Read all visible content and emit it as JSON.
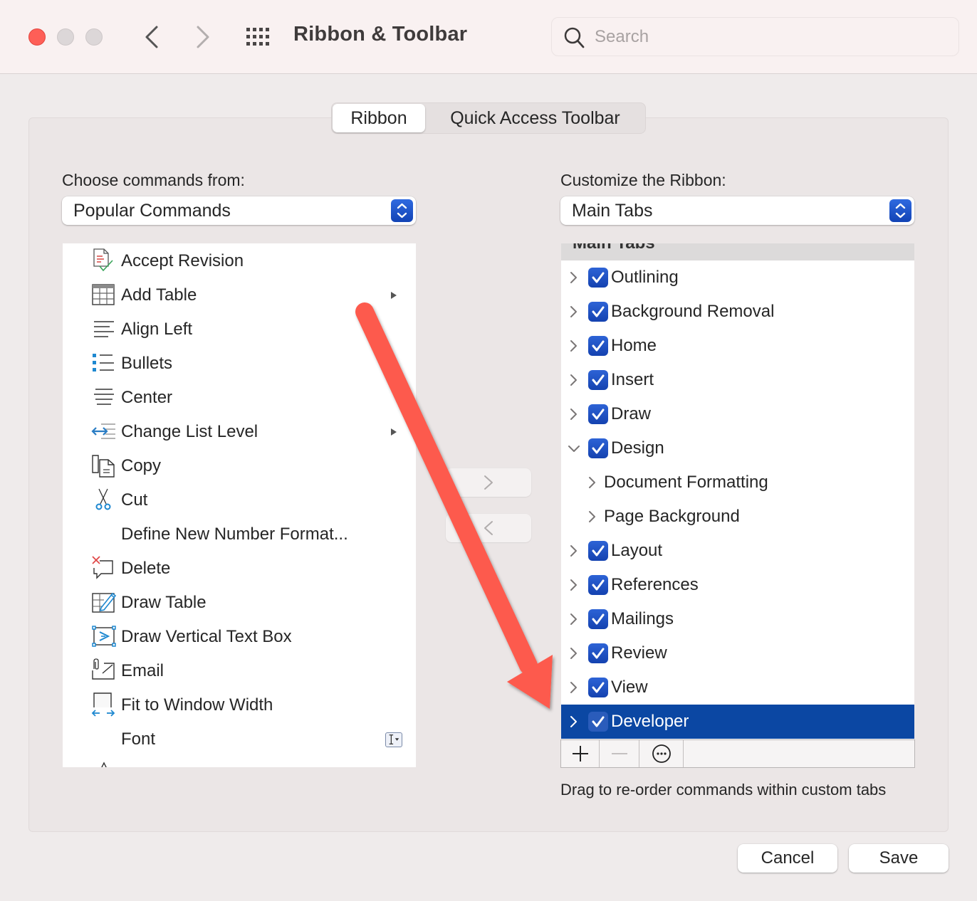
{
  "window": {
    "title": "Ribbon & Toolbar",
    "search_placeholder": "Search"
  },
  "tabs": [
    {
      "label": "Ribbon",
      "active": true
    },
    {
      "label": "Quick Access Toolbar",
      "active": false
    }
  ],
  "left": {
    "label": "Choose commands from:",
    "dropdown_value": "Popular Commands",
    "commands": [
      {
        "label": "Accept Revision",
        "icon": "accept-revision-icon",
        "submenu": false
      },
      {
        "label": "Add Table",
        "icon": "table-icon",
        "submenu": true
      },
      {
        "label": "Align Left",
        "icon": "align-left-icon",
        "submenu": false
      },
      {
        "label": "Bullets",
        "icon": "bullets-icon",
        "submenu": false
      },
      {
        "label": "Center",
        "icon": "align-center-icon",
        "submenu": false
      },
      {
        "label": "Change List Level",
        "icon": "change-list-level-icon",
        "submenu": true
      },
      {
        "label": "Copy",
        "icon": "copy-icon",
        "submenu": false
      },
      {
        "label": "Cut",
        "icon": "scissors-icon",
        "submenu": false
      },
      {
        "label": "Define New Number Format...",
        "icon": null,
        "submenu": false
      },
      {
        "label": "Delete",
        "icon": "delete-comment-icon",
        "submenu": false
      },
      {
        "label": "Draw Table",
        "icon": "draw-table-icon",
        "submenu": false
      },
      {
        "label": "Draw Vertical Text Box",
        "icon": "vertical-text-box-icon",
        "submenu": false
      },
      {
        "label": "Email",
        "icon": "email-attachment-icon",
        "submenu": false
      },
      {
        "label": "Fit to Window Width",
        "icon": "fit-width-icon",
        "submenu": false
      },
      {
        "label": "Font",
        "icon": null,
        "submenu": false,
        "trailing": "font-picker-icon"
      }
    ]
  },
  "middle": {
    "add_label": "Add",
    "remove_label": "Remove"
  },
  "right": {
    "label": "Customize the Ribbon:",
    "dropdown_value": "Main Tabs",
    "header": "Main Tabs",
    "items": [
      {
        "label": "Outlining",
        "checked": true,
        "expanded": false,
        "level": 0
      },
      {
        "label": "Background Removal",
        "checked": true,
        "expanded": false,
        "level": 0
      },
      {
        "label": "Home",
        "checked": true,
        "expanded": false,
        "level": 0
      },
      {
        "label": "Insert",
        "checked": true,
        "expanded": false,
        "level": 0
      },
      {
        "label": "Draw",
        "checked": true,
        "expanded": false,
        "level": 0
      },
      {
        "label": "Design",
        "checked": true,
        "expanded": true,
        "level": 0
      },
      {
        "label": "Document Formatting",
        "checked": null,
        "expanded": false,
        "level": 1
      },
      {
        "label": "Page Background",
        "checked": null,
        "expanded": false,
        "level": 1
      },
      {
        "label": "Layout",
        "checked": true,
        "expanded": false,
        "level": 0
      },
      {
        "label": "References",
        "checked": true,
        "expanded": false,
        "level": 0
      },
      {
        "label": "Mailings",
        "checked": true,
        "expanded": false,
        "level": 0
      },
      {
        "label": "Review",
        "checked": true,
        "expanded": false,
        "level": 0
      },
      {
        "label": "View",
        "checked": true,
        "expanded": false,
        "level": 0
      },
      {
        "label": "Developer",
        "checked": true,
        "expanded": false,
        "level": 0,
        "selected": true
      }
    ],
    "toolbar": [
      "add-icon",
      "remove-icon",
      "more-icon"
    ],
    "hint": "Drag to re-order commands within custom tabs"
  },
  "footer": {
    "cancel_label": "Cancel",
    "save_label": "Save"
  },
  "colors": {
    "accent": "#0b47a3",
    "checkbox": "#1f52c4",
    "annotation_arrow": "#fd5a4d",
    "close": "#fe5f57"
  }
}
